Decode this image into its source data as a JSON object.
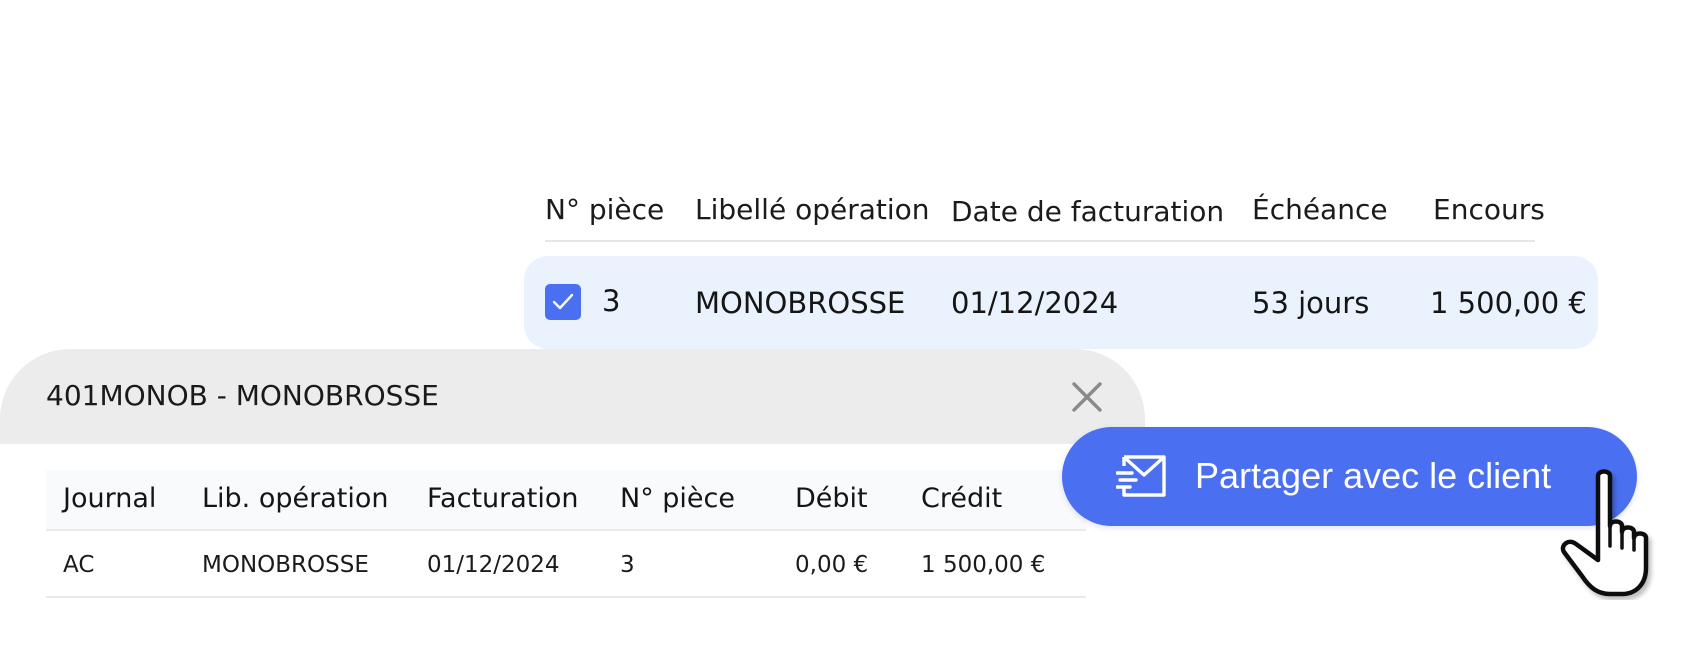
{
  "invoices": {
    "columns": [
      "N° pièce",
      "Libellé opération",
      "Date de facturation",
      "Échéance",
      "Encours"
    ],
    "rows": [
      {
        "selected": true,
        "piece": "3",
        "libelle": "MONOBROSSE",
        "date": "01/12/2024",
        "echeance": "53 jours",
        "encours": "1 500,00 €"
      }
    ]
  },
  "ledger": {
    "title": "401MONOB - MONOBROSSE",
    "close_icon": "close-icon",
    "columns": [
      "Journal",
      "Lib. opération",
      "Facturation",
      "N° pièce",
      "Débit",
      "Crédit"
    ],
    "rows": [
      {
        "journal": "AC",
        "libelle": "MONOBROSSE",
        "facturation": "01/12/2024",
        "piece": "3",
        "debit": "0,00 €",
        "credit": "1 500,00 €"
      }
    ]
  },
  "share": {
    "label": "Partager avec le client",
    "icon": "send-mail-icon",
    "cursor_icon": "pointer-hand-icon"
  },
  "colors": {
    "accent": "#4a6ff0",
    "selected_row_bg": "#eaf3fd",
    "card_header_bg": "#ececec"
  }
}
